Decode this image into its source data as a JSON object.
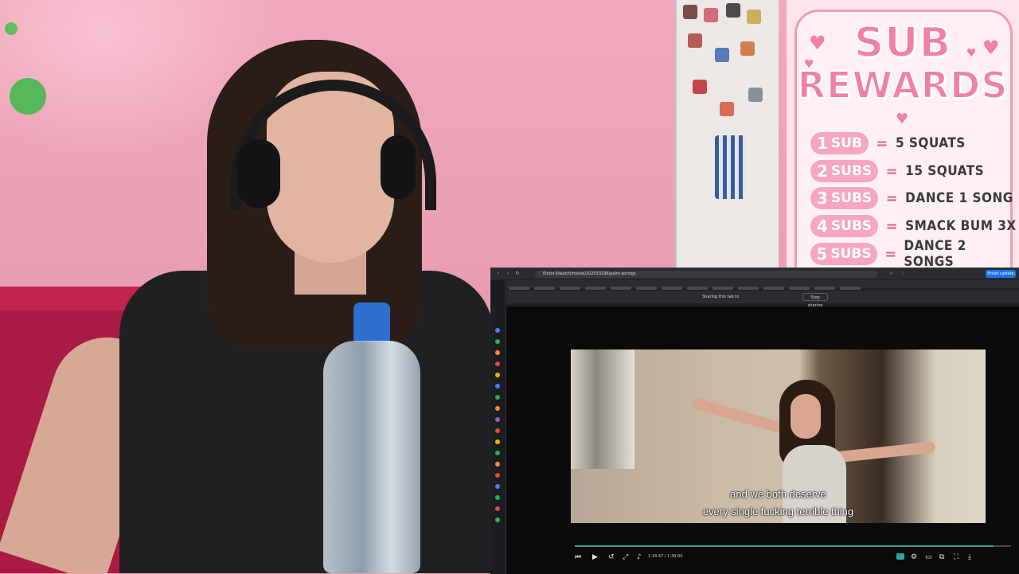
{
  "rewards": {
    "title_line1": "SUB",
    "title_line2": "REWARDS",
    "items": [
      {
        "num": "1",
        "unit": "SUB",
        "eq": "=",
        "reward": "5 SQUATS"
      },
      {
        "num": "2",
        "unit": "SUBS",
        "eq": "=",
        "reward": "15 SQUATS"
      },
      {
        "num": "3",
        "unit": "SUBS",
        "eq": "=",
        "reward": "DANCE 1 SONG"
      },
      {
        "num": "4",
        "unit": "SUBS",
        "eq": "=",
        "reward": "SMACK BUM 3X"
      },
      {
        "num": "5",
        "unit": "SUBS",
        "eq": "=",
        "reward": "DANCE 2 SONGS"
      }
    ],
    "colors": {
      "accent": "#f27fa7",
      "badge": "#f7a6bf",
      "panel": "#fff0f4"
    }
  },
  "browser": {
    "url": "flixtor.li/watch/movie/102033196/palm-springs",
    "share_text": "Sharing this tab to",
    "stop_label": "Stop sharing",
    "top_button": "Finish update",
    "icons": [
      "back-icon",
      "forward-icon",
      "reload-icon",
      "star-icon",
      "extensions-icon"
    ]
  },
  "player": {
    "subtitle_line1": "and we both deserve",
    "subtitle_line2": "every single fucking terrible thing",
    "time": "1:34:47 / 1:39:00",
    "progress": 0.96,
    "icons": [
      "skip-back-icon",
      "play-icon",
      "rewind-icon",
      "fullscreen-small-icon",
      "volume-icon",
      "captions-icon",
      "settings-icon",
      "theater-icon",
      "pip-icon",
      "fullscreen-icon",
      "download-icon"
    ]
  }
}
